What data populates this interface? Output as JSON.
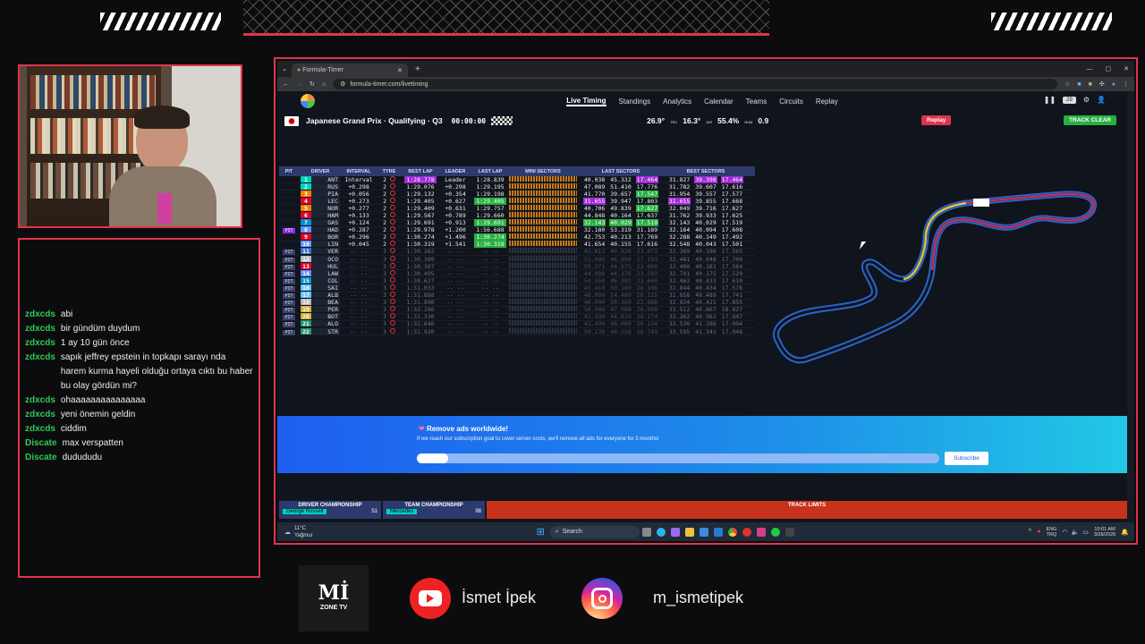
{
  "browser": {
    "tab_title": "Formula-Timer",
    "url": "formula-timer.com/livetiming"
  },
  "nav": {
    "items": [
      "Live Timing",
      "Standings",
      "Analytics",
      "Calendar",
      "Teams",
      "Circuits",
      "Replay"
    ],
    "viewers": "29"
  },
  "session": {
    "title": "Japanese Grand Prix · Qualifying · Q3",
    "clock": "00:00:00",
    "track_temp": "26.9°",
    "track_unit": "TRC",
    "air_temp": "16.3°",
    "air_unit": "AIR",
    "humidity": "55.4%",
    "hum_unit": "HUM",
    "wind": "0.9",
    "replay_button": "Replay",
    "track_status": "TRACK CLEAR"
  },
  "table": {
    "headers": [
      "PIT",
      "DRIVER",
      "INTERVAL",
      "TYRE",
      "BEST LAP",
      "LEADER",
      "LAST LAP",
      "MINI SECTORS",
      "LAST SECTORS",
      "BEST SECTORS"
    ],
    "rows": [
      {
        "pit": "",
        "pos": "1",
        "drv": "ANT",
        "col": "#00d2be",
        "int": "Interval",
        "tyre": "2",
        "best": "1:28.778",
        "lead": "Leader",
        "last": "1:28.839",
        "ls": [
          "40.038",
          "45.332",
          "17.464"
        ],
        "bs": [
          "31.827",
          "39.398",
          "17.464"
        ],
        "bestc": "pur",
        "lastc": "",
        "ls3c": "pur",
        "bs2c": "pur",
        "bs3c": "pur",
        "active": true
      },
      {
        "pit": "",
        "pos": "2",
        "drv": "RUS",
        "col": "#00d2be",
        "int": "+0.298",
        "tyre": "2",
        "best": "1:29.076",
        "lead": "+0.298",
        "last": "1:29.195",
        "ls": [
          "47.089",
          "51.410",
          "17.776"
        ],
        "bs": [
          "31.782",
          "39.607",
          "17.616"
        ],
        "active": true
      },
      {
        "pit": "",
        "pos": "3",
        "drv": "PIA",
        "col": "#ff8000",
        "int": "+0.056",
        "tyre": "2",
        "best": "1:29.132",
        "lead": "+0.354",
        "last": "1:29.198",
        "ls": [
          "41.770",
          "39.657",
          "17.547"
        ],
        "bs": [
          "31.954",
          "39.557",
          "17.577"
        ],
        "ls3c": "grn",
        "active": true
      },
      {
        "pit": "",
        "pos": "4",
        "drv": "LEC",
        "col": "#e8002d",
        "int": "+0.273",
        "tyre": "2",
        "best": "1:29.405",
        "lead": "+0.627",
        "last": "1:29.405",
        "ls": [
          "31.655",
          "39.947",
          "17.803"
        ],
        "bs": [
          "31.655",
          "39.855",
          "17.668"
        ],
        "lastc": "grn",
        "ls1c": "pur",
        "bs1c": "pur",
        "active": true
      },
      {
        "pit": "",
        "pos": "5",
        "drv": "NOR",
        "col": "#ff8000",
        "int": "+0.277",
        "tyre": "2",
        "best": "1:29.409",
        "lead": "+0.631",
        "last": "1:29.757",
        "ls": [
          "40.706",
          "49.839",
          "17.627"
        ],
        "bs": [
          "32.049",
          "39.716",
          "17.627"
        ],
        "ls3c": "grn",
        "active": true
      },
      {
        "pit": "",
        "pos": "6",
        "drv": "HAM",
        "col": "#e8002d",
        "int": "+0.133",
        "tyre": "2",
        "best": "1:29.567",
        "lead": "+0.789",
        "last": "1:29.660",
        "ls": [
          "44.848",
          "40.164",
          "17.637"
        ],
        "bs": [
          "31.762",
          "39.933",
          "17.625"
        ],
        "active": true
      },
      {
        "pit": "",
        "pos": "7",
        "drv": "GAS",
        "col": "#0093cc",
        "int": "+0.124",
        "tyre": "2",
        "best": "1:29.691",
        "lead": "+0.913",
        "last": "1:29.691",
        "ls": [
          "32.143",
          "40.029",
          "17.519"
        ],
        "bs": [
          "32.143",
          "40.029",
          "17.519"
        ],
        "lastc": "grn",
        "ls1c": "grn",
        "ls2c": "grn",
        "ls3c": "grn",
        "active": true
      },
      {
        "pit": "PIT",
        "pitact": true,
        "pos": "8",
        "drv": "HAD",
        "col": "#6692ff",
        "int": "+0.287",
        "tyre": "2",
        "best": "1:29.978",
        "lead": "+1.200",
        "last": "1:56.688",
        "ls": [
          "32.180",
          "53.319",
          "31.189"
        ],
        "bs": [
          "32.164",
          "40.094",
          "17.608"
        ],
        "active": true
      },
      {
        "pit": "",
        "pos": "9",
        "drv": "BOR",
        "col": "#e8002d",
        "int": "+0.296",
        "tyre": "2",
        "best": "1:30.274",
        "lead": "+1.496",
        "last": "1:30.274",
        "ls": [
          "42.753",
          "40.213",
          "17.769"
        ],
        "bs": [
          "32.288",
          "40.149",
          "17.492"
        ],
        "lastc": "grn",
        "active": true
      },
      {
        "pit": "",
        "pos": "10",
        "drv": "LIN",
        "col": "#6692ff",
        "int": "+0.045",
        "tyre": "2",
        "best": "1:30.319",
        "lead": "+1.541",
        "last": "1:30.319",
        "ls": [
          "41.654",
          "40.155",
          "17.616"
        ],
        "bs": [
          "32.548",
          "40.043",
          "17.501"
        ],
        "lastc": "grn",
        "active": true
      },
      {
        "pit": "PIT",
        "pos": "11",
        "drv": "VER",
        "col": "#3671c6",
        "int": "-- --",
        "tyre": "3",
        "best": "1:30.262",
        "lead": "-- --",
        "last": "-- --",
        "ls": [
          "42.613",
          "40.826",
          "23.073"
        ],
        "bs": [
          "32.369",
          "40.196",
          "17.565"
        ]
      },
      {
        "pit": "PIT",
        "pos": "12",
        "drv": "OCO",
        "col": "#b6babd",
        "int": "-- --",
        "tyre": "3",
        "best": "1:30.309",
        "lead": "-- --",
        "last": "-- --",
        "ls": [
          "51.000",
          "46.898",
          "27.193"
        ],
        "bs": [
          "32.481",
          "40.048",
          "17.700"
        ]
      },
      {
        "pit": "PIT",
        "pos": "13",
        "drv": "HUL",
        "col": "#e8002d",
        "int": "-- --",
        "tyre": "3",
        "best": "1:30.387",
        "lead": "-- --",
        "last": "-- --",
        "ls": [
          "55.371",
          "44.575",
          "23.000"
        ],
        "bs": [
          "32.480",
          "40.181",
          "17.564"
        ]
      },
      {
        "pit": "PIT",
        "pos": "14",
        "drv": "LAW",
        "col": "#6692ff",
        "int": "-- --",
        "tyre": "3",
        "best": "1:30.495",
        "lead": "-- --",
        "last": "-- --",
        "ls": [
          "44.088",
          "44.176",
          "23.592"
        ],
        "bs": [
          "32.791",
          "40.175",
          "17.529"
        ]
      },
      {
        "pit": "PIT",
        "pos": "15",
        "drv": "COL",
        "col": "#0093cc",
        "int": "-- --",
        "tyre": "3",
        "best": "1:30.627",
        "lead": "-- --",
        "last": "-- --",
        "ls": [
          "54.550",
          "46.992",
          "23.600"
        ],
        "bs": [
          "32.463",
          "40.433",
          "17.610"
        ]
      },
      {
        "pit": "PIT",
        "pos": "16",
        "drv": "SAI",
        "col": "#64c4ff",
        "int": "-- --",
        "tyre": "3",
        "best": "1:31.033",
        "lead": "-- --",
        "last": "-- --",
        "ls": [
          "45.410",
          "50.180",
          "26.106"
        ],
        "bs": [
          "32.844",
          "40.434",
          "17.576"
        ]
      },
      {
        "pit": "PIT",
        "pos": "17",
        "drv": "ALB",
        "col": "#64c4ff",
        "int": "-- --",
        "tyre": "3",
        "best": "1:31.888",
        "lead": "-- --",
        "last": "-- --",
        "ls": [
          "48.009",
          "54.489",
          "26.115"
        ],
        "bs": [
          "32.858",
          "40.489",
          "17.741"
        ]
      },
      {
        "pit": "PIT",
        "pos": "18",
        "drv": "BEA",
        "col": "#b6babd",
        "int": "-- --",
        "tyre": "3",
        "best": "1:31.890",
        "lead": "-- --",
        "last": "-- --",
        "ls": [
          "46.000",
          "50.369",
          "22.888"
        ],
        "bs": [
          "32.824",
          "40.421",
          "17.855"
        ]
      },
      {
        "pit": "PIT",
        "pos": "19",
        "drv": "PER",
        "col": "#d4af37",
        "int": "-- --",
        "tyre": "3",
        "best": "1:32.286",
        "lead": "-- --",
        "last": "-- --",
        "ls": [
          "50.004",
          "47.088",
          "20.098"
        ],
        "bs": [
          "33.512",
          "40.667",
          "18.827"
        ]
      },
      {
        "pit": "PIT",
        "pos": "20",
        "drv": "BOT",
        "col": "#d4af37",
        "int": "-- --",
        "tyre": "3",
        "best": "1:32.330",
        "lead": "-- --",
        "last": "-- --",
        "ls": [
          "41.430",
          "44.810",
          "26.174"
        ],
        "bs": [
          "33.362",
          "40.961",
          "17.947"
        ]
      },
      {
        "pit": "PIT",
        "pos": "21",
        "drv": "ALO",
        "col": "#229971",
        "int": "-- --",
        "tyre": "3",
        "best": "1:32.646",
        "lead": "-- --",
        "last": "-- --",
        "ls": [
          "41.490",
          "48.000",
          "26.134"
        ],
        "bs": [
          "33.536",
          "41.286",
          "17.904"
        ]
      },
      {
        "pit": "PIT",
        "pos": "22",
        "drv": "STR",
        "col": "#229971",
        "int": "-- --",
        "tyre": "3",
        "best": "1:32.920",
        "lead": "-- --",
        "last": "-- --",
        "ls": [
          "50.136",
          "48.256",
          "26.749"
        ],
        "bs": [
          "33.595",
          "41.341",
          "17.948"
        ]
      }
    ]
  },
  "ad": {
    "title": "Remove ads worldwide!",
    "text": "If we reach our subscription goal to cover server costs, we'll remove all ads for everyone for 3 months!",
    "button": "Subscribe",
    "progress": 0.06
  },
  "bottom": {
    "driver_champ": "DRIVER CHAMPIONSHIP",
    "driver_leader": "George Russell",
    "driver_pts": "51",
    "team_champ": "TEAM CHAMPIONSHIP",
    "team_leader": "Mercedes",
    "team_pts": "98",
    "track_limits": "TRACK LIMITS"
  },
  "taskbar": {
    "weather_temp": "11°C",
    "weather_desc": "Yağmur",
    "search": "Search",
    "lang1": "ENG",
    "lang2": "TRQ",
    "time": "10:01 AM",
    "date": "3/28/2026"
  },
  "chat": [
    {
      "user": "zdxcds",
      "text": "abi"
    },
    {
      "user": "zdxcds",
      "text": "bir gündüm duydum"
    },
    {
      "user": "zdxcds",
      "text": "1 ay 10 gün önce"
    },
    {
      "user": "zdxcds",
      "text": "sapık jeffrey epstein in topkapı sarayı nda harem kurma hayeli olduğu ortaya cıktı bu haber bu olay gördün mi?"
    },
    {
      "user": "zdxcds",
      "text": "ohaaaaaaaaaaaaaaa"
    },
    {
      "user": "zdxcds",
      "text": "yeni önemin geldin"
    },
    {
      "user": "zdxcds",
      "text": "ciddim"
    },
    {
      "user": "Discate",
      "text": "max verspatten"
    },
    {
      "user": "Discate",
      "text": "dudududu"
    }
  ],
  "socials": {
    "logo_main": "Mİ",
    "logo_sub": "ZONE TV",
    "youtube": "İsmet İpek",
    "instagram": "m_ismetipek"
  },
  "colors": {
    "accent": "#e0344a",
    "purple": "#a02bd8",
    "green": "#27b042"
  }
}
